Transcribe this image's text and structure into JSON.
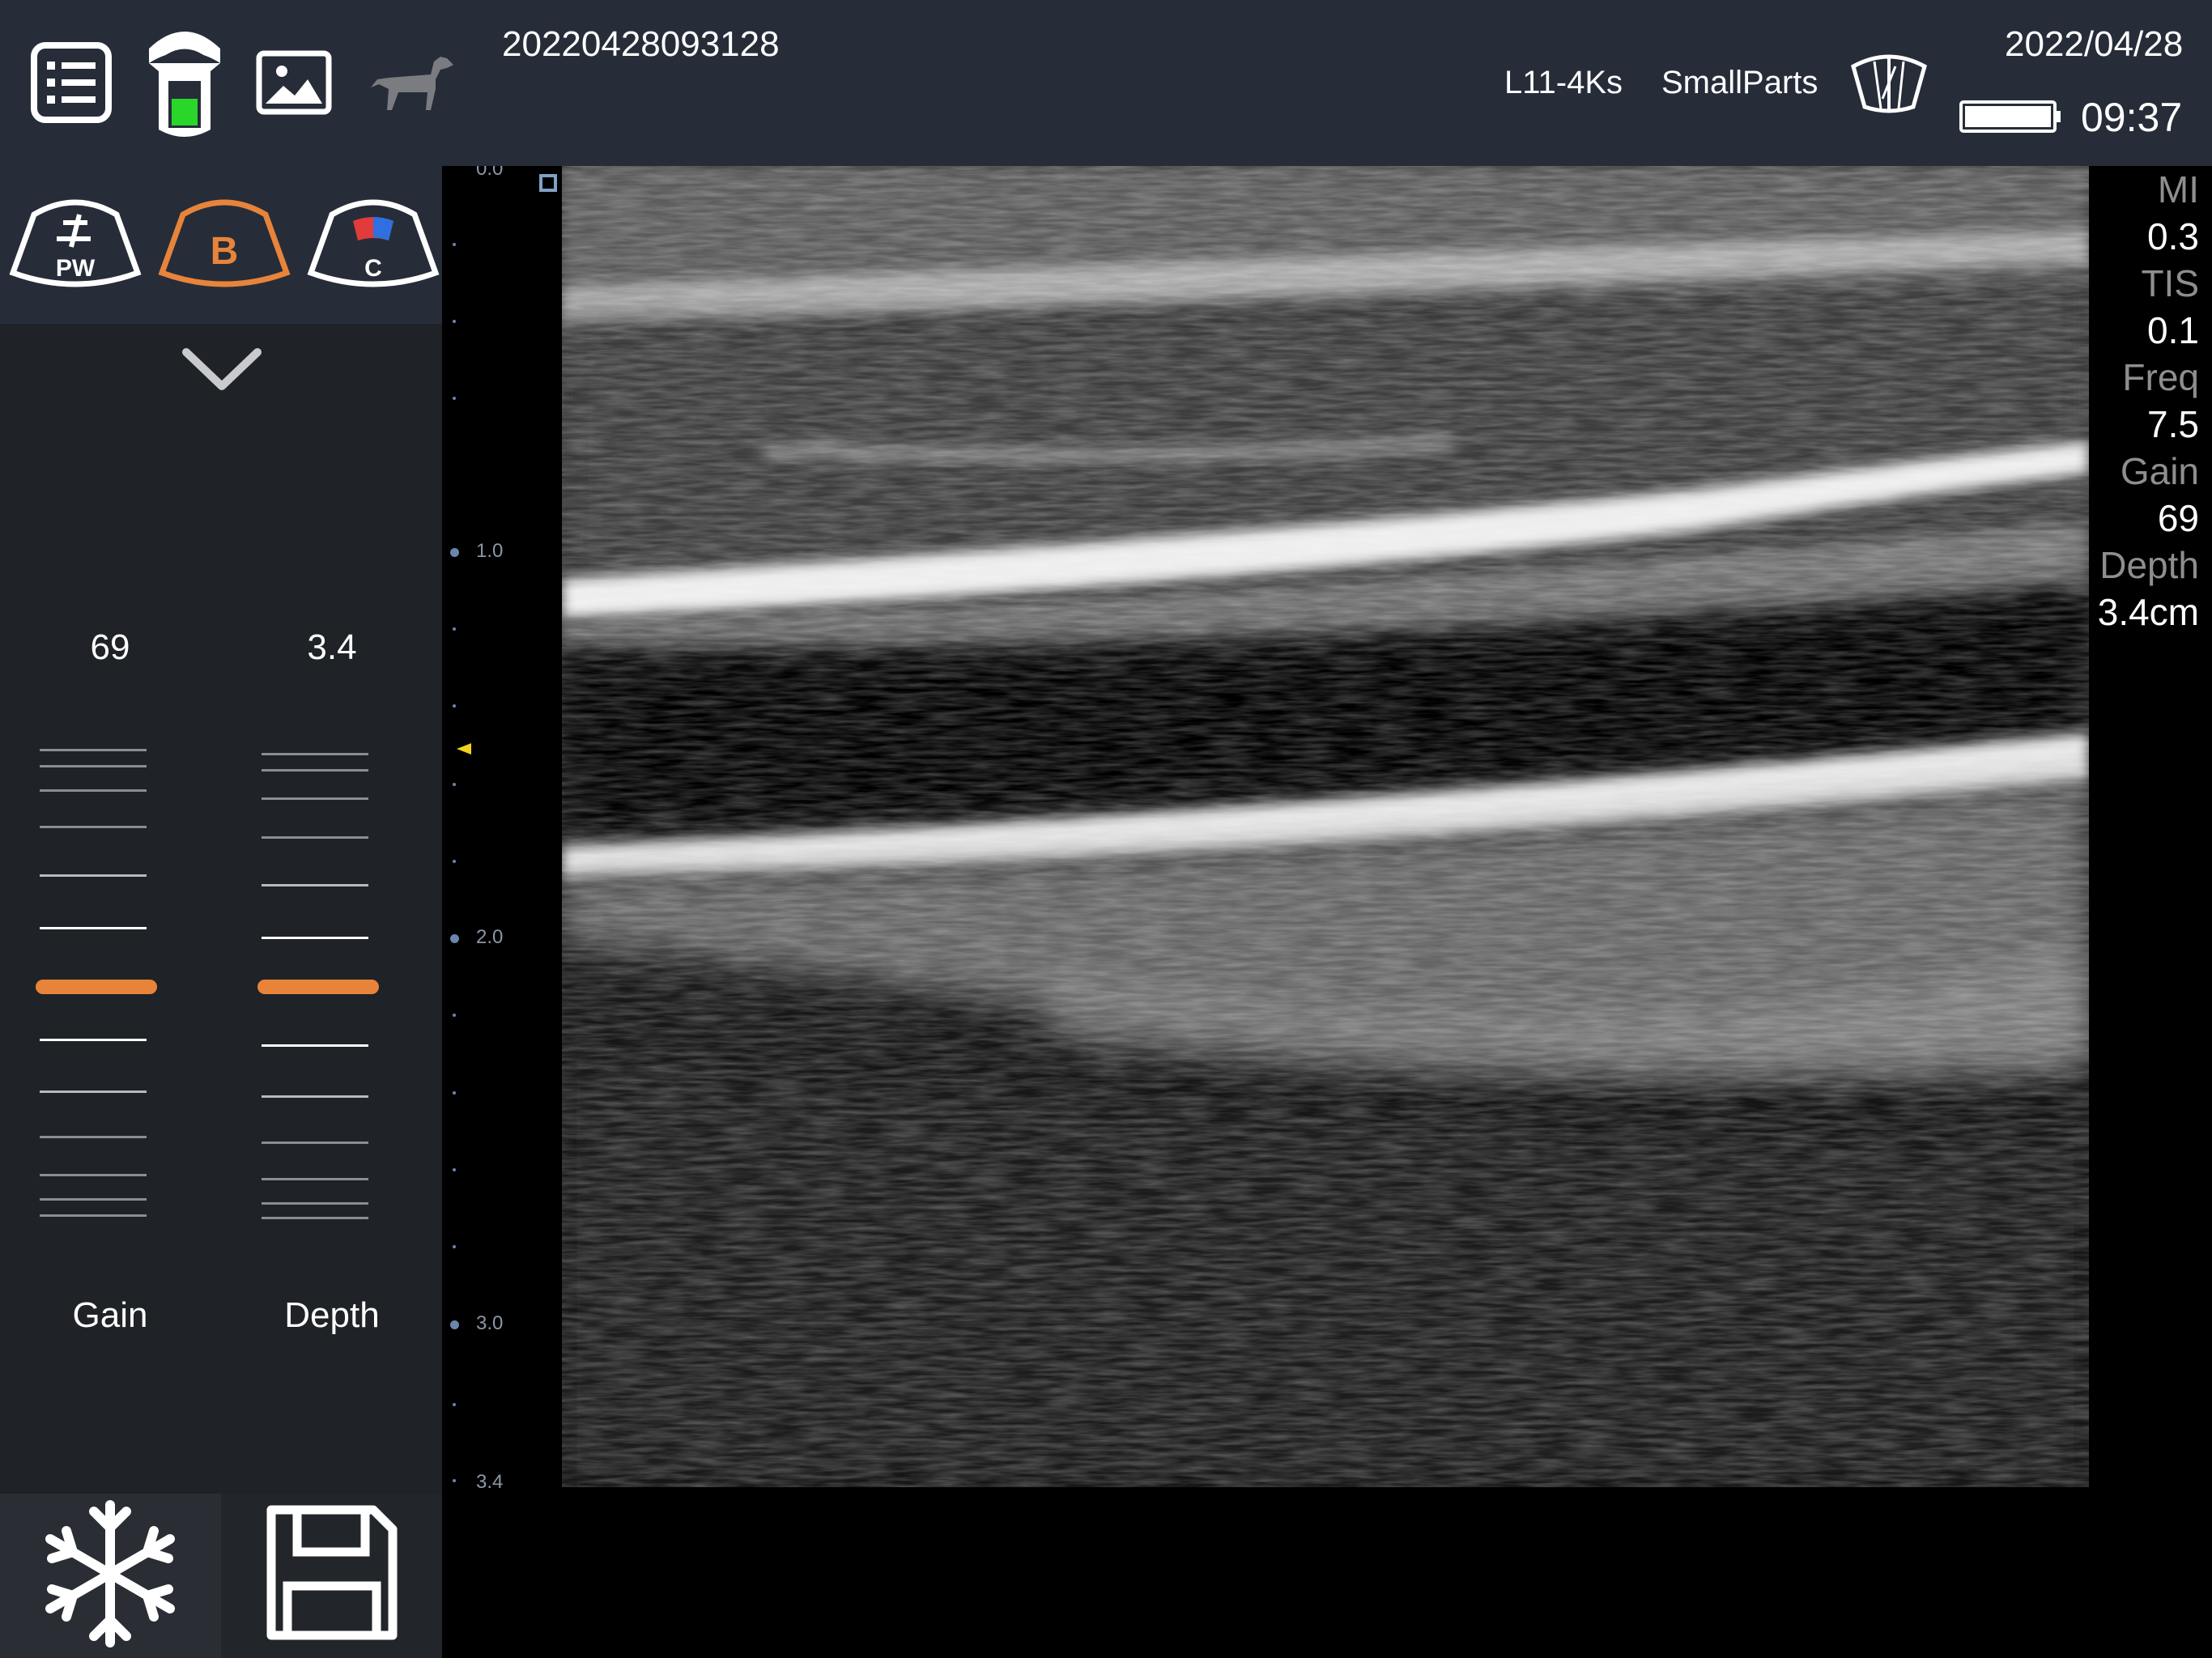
{
  "header": {
    "exam_id": "20220428093128",
    "probe": "L11-4Ks",
    "preset": "SmallParts",
    "date": "2022/04/28",
    "time": "09:37",
    "icons": [
      "list-icon",
      "probe-battery-icon",
      "image-gallery-icon",
      "dog-icon",
      "sector-probe-icon",
      "battery-icon"
    ]
  },
  "modes": {
    "pw_label": "PW",
    "b_label": "B",
    "c_label": "C",
    "active": "B",
    "accent_color": "#e8843a"
  },
  "controls": {
    "gain": {
      "label": "Gain",
      "value": "69"
    },
    "depth": {
      "label": "Depth",
      "value": "3.4"
    }
  },
  "scale": {
    "top_label": "0.0",
    "labels": [
      "1.0",
      "2.0",
      "3.0"
    ],
    "bottom_label": "3.4"
  },
  "params": {
    "mi_label": "MI",
    "mi_value": "0.3",
    "tis_label": "TIS",
    "tis_value": "0.1",
    "freq_label": "Freq",
    "freq_value": "7.5",
    "gain_label": "Gain",
    "gain_value": "69",
    "depth_label": "Depth",
    "depth_value": "3.4cm"
  },
  "bottom": {
    "icons": [
      "snowflake-icon",
      "save-icon"
    ]
  }
}
